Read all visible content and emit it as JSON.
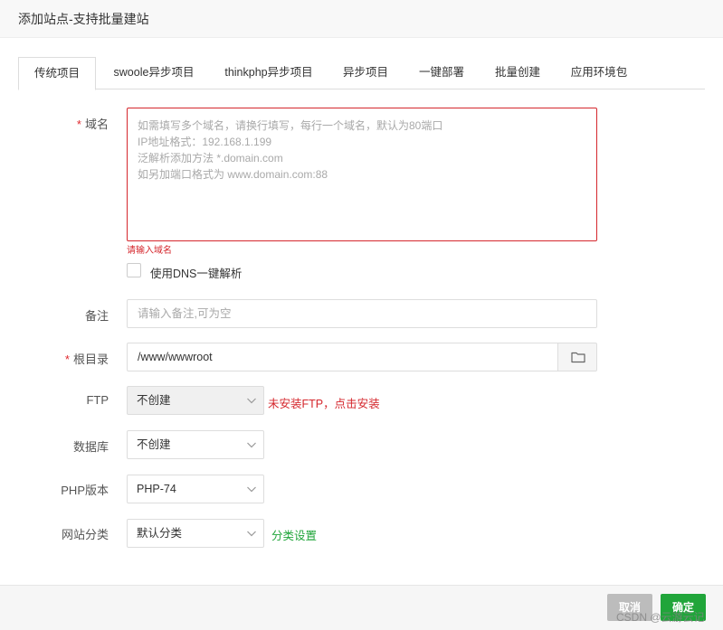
{
  "dialog": {
    "title": "添加站点-支持批量建站"
  },
  "tabs": [
    {
      "label": "传统项目",
      "active": true
    },
    {
      "label": "swoole异步项目"
    },
    {
      "label": "thinkphp异步项目"
    },
    {
      "label": "异步项目"
    },
    {
      "label": "一键部署"
    },
    {
      "label": "批量创建"
    },
    {
      "label": "应用环境包"
    }
  ],
  "form": {
    "required_mark": "*",
    "domain": {
      "label": "域名",
      "placeholder_lines": [
        "如需填写多个域名，请换行填写，每行一个域名，默认为80端口",
        "IP地址格式：192.168.1.199",
        "泛解析添加方法 *.domain.com",
        "如另加端口格式为 www.domain.com:88"
      ],
      "error": "请输入域名"
    },
    "dns_checkbox": {
      "label": "使用DNS一键解析",
      "checked": false
    },
    "remark": {
      "label": "备注",
      "placeholder": "请输入备注,可为空"
    },
    "root_dir": {
      "label": "根目录",
      "value": "/www/wwwroot"
    },
    "ftp": {
      "label": "FTP",
      "value": "不创建",
      "hint": "未安装FTP，点击安装"
    },
    "database": {
      "label": "数据库",
      "value": "不创建"
    },
    "php_version": {
      "label": "PHP版本",
      "value": "PHP-74"
    },
    "site_category": {
      "label": "网站分类",
      "value": "默认分类",
      "hint": "分类设置"
    }
  },
  "footer": {
    "cancel_label": "取消",
    "ok_label": "确定"
  },
  "watermark": "CSDN @云游云记",
  "colors": {
    "accent_green": "#20a53a",
    "error_red": "#d5272d"
  }
}
